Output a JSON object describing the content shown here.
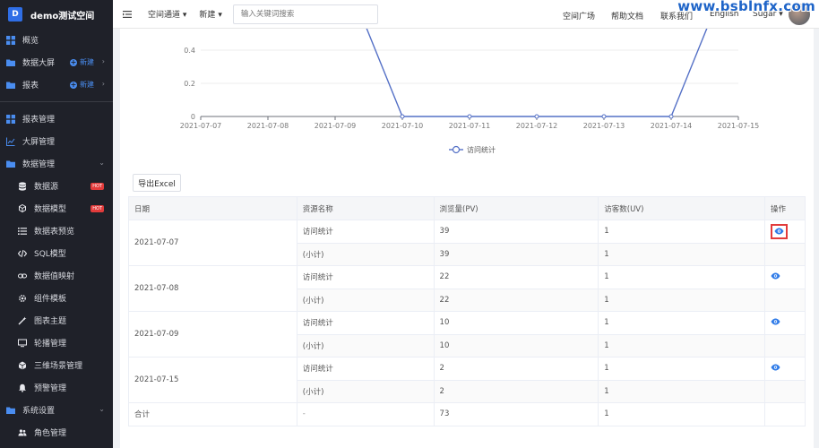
{
  "app": {
    "badge": "D",
    "name": "demo测试空间"
  },
  "sidebar": {
    "top": [
      {
        "label": "概览",
        "icon": "grid-icon"
      },
      {
        "label": "数据大屏",
        "icon": "folder-icon",
        "new": "新建"
      },
      {
        "label": "报表",
        "icon": "folder-icon",
        "new": "新建"
      }
    ],
    "mgmt": [
      {
        "label": "报表管理",
        "icon": "grid-icon"
      },
      {
        "label": "大屏管理",
        "icon": "chart-line-icon"
      },
      {
        "label": "数据管理",
        "icon": "folder-icon"
      }
    ],
    "data_sub": [
      {
        "label": "数据源",
        "icon": "database-icon",
        "hot": "HOT"
      },
      {
        "label": "数据模型",
        "icon": "cubes-icon",
        "hot": "HOT"
      },
      {
        "label": "数据表预览",
        "icon": "list-icon"
      },
      {
        "label": "SQL模型",
        "icon": "code-icon"
      },
      {
        "label": "数据值映射",
        "icon": "link-icon"
      },
      {
        "label": "组件模板",
        "icon": "settings-icon"
      },
      {
        "label": "图表主题",
        "icon": "wand-icon"
      },
      {
        "label": "轮播管理",
        "icon": "monitor-icon"
      },
      {
        "label": "三维场景管理",
        "icon": "cube-icon"
      },
      {
        "label": "预警管理",
        "icon": "bell-icon"
      }
    ],
    "sys": {
      "label": "系统设置",
      "icon": "folder-icon"
    },
    "sys_sub": [
      {
        "label": "角色管理",
        "icon": "users-icon"
      }
    ]
  },
  "topbar": {
    "space_channel": "空间通道",
    "new": "新建",
    "search_placeholder": "输入关键词搜索",
    "square": "空间广场",
    "help": "帮助文档",
    "contact": "联系我们",
    "lang": "English",
    "user": "Sugar",
    "watermark": "www.bsblnfx.com"
  },
  "chart_data": {
    "type": "line",
    "x": [
      "2021-07-07",
      "2021-07-08",
      "2021-07-09",
      "2021-07-10",
      "2021-07-11",
      "2021-07-12",
      "2021-07-13",
      "2021-07-14",
      "2021-07-15"
    ],
    "series": [
      {
        "name": "访问统计",
        "values": [
          1,
          1,
          1,
          0,
          0,
          0,
          0,
          0,
          1
        ]
      }
    ],
    "y_ticks": [
      "0",
      "0.2",
      "0.4"
    ],
    "ylim": [
      0,
      1
    ],
    "color": "#5470c6"
  },
  "export_label": "导出Excel",
  "table": {
    "headers": [
      "日期",
      "资源名称",
      "浏览量(PV)",
      "访客数(UV)",
      "操作"
    ],
    "groups": [
      {
        "date": "2021-07-07",
        "rows": [
          [
            "访问统计",
            "39",
            "1"
          ],
          [
            "(小计)",
            "39",
            "1"
          ]
        ]
      },
      {
        "date": "2021-07-08",
        "rows": [
          [
            "访问统计",
            "22",
            "1"
          ],
          [
            "(小计)",
            "22",
            "1"
          ]
        ]
      },
      {
        "date": "2021-07-09",
        "rows": [
          [
            "访问统计",
            "10",
            "1"
          ],
          [
            "(小计)",
            "10",
            "1"
          ]
        ]
      },
      {
        "date": "2021-07-15",
        "rows": [
          [
            "访问统计",
            "2",
            "1"
          ],
          [
            "(小计)",
            "2",
            "1"
          ]
        ]
      }
    ],
    "total": [
      "合计",
      "-",
      "73",
      "1"
    ]
  }
}
